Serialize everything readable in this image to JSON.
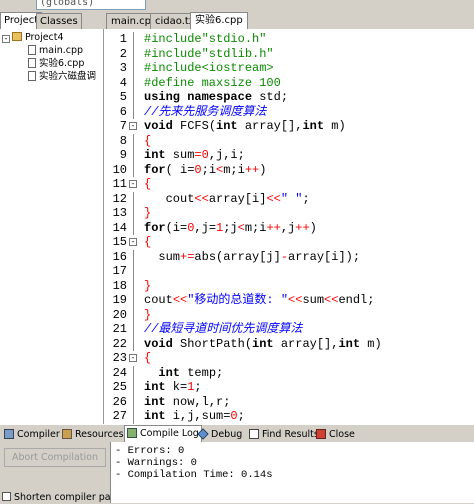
{
  "toolbar": {
    "scope_select": "(globals)"
  },
  "left_panel": {
    "tabs": [
      "Project",
      "Classes"
    ],
    "project_name": "Project4",
    "files": [
      "main.cpp",
      "实验6.cpp",
      "实验六磁盘调"
    ]
  },
  "file_tabs": [
    "main.cpp",
    "cidao.txt",
    "实验6.cpp"
  ],
  "editor": {
    "lines": [
      {
        "n": "1",
        "fold": "",
        "tokens": [
          {
            "t": "#include\"stdio.h\"",
            "c": "pp"
          }
        ]
      },
      {
        "n": "2",
        "fold": "",
        "tokens": [
          {
            "t": "#include\"stdlib.h\"",
            "c": "pp"
          }
        ]
      },
      {
        "n": "3",
        "fold": "",
        "tokens": [
          {
            "t": "#include<iostream>",
            "c": "pp"
          }
        ]
      },
      {
        "n": "4",
        "fold": "",
        "tokens": [
          {
            "t": "#define maxsize 100",
            "c": "pp"
          }
        ]
      },
      {
        "n": "5",
        "fold": "",
        "tokens": [
          {
            "t": "using namespace",
            "c": "kw"
          },
          {
            "t": " std;",
            "c": ""
          }
        ]
      },
      {
        "n": "6",
        "fold": "",
        "tokens": [
          {
            "t": "//先来先服务调度算法",
            "c": "cm"
          }
        ]
      },
      {
        "n": "7",
        "fold": "-",
        "tokens": [
          {
            "t": "void",
            "c": "kw"
          },
          {
            "t": " FCFS(",
            "c": ""
          },
          {
            "t": "int",
            "c": "kw"
          },
          {
            "t": " array[],",
            "c": ""
          },
          {
            "t": "int",
            "c": "kw"
          },
          {
            "t": " m)",
            "c": ""
          }
        ]
      },
      {
        "n": "8",
        "fold": "",
        "tokens": [
          {
            "t": "{",
            "c": "sym"
          }
        ]
      },
      {
        "n": "9",
        "fold": "",
        "tokens": [
          {
            "t": "int",
            "c": "kw"
          },
          {
            "t": " sum",
            "c": ""
          },
          {
            "t": "=",
            "c": "sym"
          },
          {
            "t": "0",
            "c": "num"
          },
          {
            "t": ",j,i;",
            "c": ""
          }
        ]
      },
      {
        "n": "10",
        "fold": "",
        "tokens": [
          {
            "t": "for",
            "c": "kw"
          },
          {
            "t": "( i=",
            "c": ""
          },
          {
            "t": "0",
            "c": "num"
          },
          {
            "t": ";i",
            "c": ""
          },
          {
            "t": "<",
            "c": "sym"
          },
          {
            "t": "m;i",
            "c": ""
          },
          {
            "t": "++",
            "c": "sym"
          },
          {
            "t": ")",
            "c": ""
          }
        ]
      },
      {
        "n": "11",
        "fold": "-",
        "tokens": [
          {
            "t": "{",
            "c": "sym"
          }
        ]
      },
      {
        "n": "12",
        "fold": "",
        "tokens": [
          {
            "t": "   cout",
            "c": ""
          },
          {
            "t": "<<",
            "c": "sym"
          },
          {
            "t": "array[i]",
            "c": ""
          },
          {
            "t": "<<",
            "c": "sym"
          },
          {
            "t": "\" \"",
            "c": "str"
          },
          {
            "t": ";",
            "c": ""
          }
        ]
      },
      {
        "n": "13",
        "fold": "",
        "tokens": [
          {
            "t": "}",
            "c": "sym"
          }
        ]
      },
      {
        "n": "14",
        "fold": "",
        "tokens": [
          {
            "t": "for",
            "c": "kw"
          },
          {
            "t": "(i=",
            "c": ""
          },
          {
            "t": "0",
            "c": "num"
          },
          {
            "t": ",j=",
            "c": ""
          },
          {
            "t": "1",
            "c": "num"
          },
          {
            "t": ";j",
            "c": ""
          },
          {
            "t": "<",
            "c": "sym"
          },
          {
            "t": "m;i",
            "c": ""
          },
          {
            "t": "++",
            "c": "sym"
          },
          {
            "t": ",j",
            "c": ""
          },
          {
            "t": "++",
            "c": "sym"
          },
          {
            "t": ")",
            "c": ""
          }
        ]
      },
      {
        "n": "15",
        "fold": "-",
        "tokens": [
          {
            "t": "{",
            "c": "sym"
          }
        ]
      },
      {
        "n": "16",
        "fold": "",
        "tokens": [
          {
            "t": "  sum",
            "c": ""
          },
          {
            "t": "+=",
            "c": "sym"
          },
          {
            "t": "abs(array[j]",
            "c": ""
          },
          {
            "t": "-",
            "c": "sym"
          },
          {
            "t": "array[i]);",
            "c": ""
          }
        ]
      },
      {
        "n": "17",
        "fold": "",
        "tokens": [
          {
            "t": "",
            "c": ""
          }
        ]
      },
      {
        "n": "18",
        "fold": "",
        "tokens": [
          {
            "t": "}",
            "c": "sym"
          }
        ]
      },
      {
        "n": "19",
        "fold": "",
        "tokens": [
          {
            "t": "cout",
            "c": ""
          },
          {
            "t": "<<",
            "c": "sym"
          },
          {
            "t": "\"移动的总道数: \"",
            "c": "str"
          },
          {
            "t": "<<",
            "c": "sym"
          },
          {
            "t": "sum",
            "c": ""
          },
          {
            "t": "<<",
            "c": "sym"
          },
          {
            "t": "endl;",
            "c": ""
          }
        ]
      },
      {
        "n": "20",
        "fold": "",
        "tokens": [
          {
            "t": "}",
            "c": "sym"
          }
        ]
      },
      {
        "n": "21",
        "fold": "",
        "tokens": [
          {
            "t": "//最短寻道时间优先调度算法",
            "c": "cm"
          }
        ]
      },
      {
        "n": "22",
        "fold": "",
        "tokens": [
          {
            "t": "void",
            "c": "kw"
          },
          {
            "t": " ShortPath(",
            "c": ""
          },
          {
            "t": "int",
            "c": "kw"
          },
          {
            "t": " array[],",
            "c": ""
          },
          {
            "t": "int",
            "c": "kw"
          },
          {
            "t": " m)",
            "c": ""
          }
        ]
      },
      {
        "n": "23",
        "fold": "-",
        "tokens": [
          {
            "t": "{",
            "c": "sym"
          }
        ]
      },
      {
        "n": "24",
        "fold": "",
        "tokens": [
          {
            "t": "  int",
            "c": "kw"
          },
          {
            "t": " temp;",
            "c": ""
          }
        ]
      },
      {
        "n": "25",
        "fold": "",
        "tokens": [
          {
            "t": "int",
            "c": "kw"
          },
          {
            "t": " k=",
            "c": ""
          },
          {
            "t": "1",
            "c": "num"
          },
          {
            "t": ";",
            "c": ""
          }
        ]
      },
      {
        "n": "26",
        "fold": "",
        "tokens": [
          {
            "t": "int",
            "c": "kw"
          },
          {
            "t": " now,l,r;",
            "c": ""
          }
        ]
      },
      {
        "n": "27",
        "fold": "",
        "tokens": [
          {
            "t": "int",
            "c": "kw"
          },
          {
            "t": " i,j,sum=",
            "c": ""
          },
          {
            "t": "0",
            "c": "num"
          },
          {
            "t": ";",
            "c": ""
          }
        ]
      }
    ]
  },
  "bottom_tabs": [
    "Compiler",
    "Resources",
    "Compile Log",
    "Debug",
    "Find Results",
    "Close"
  ],
  "bottom_panel": {
    "abort_button": "Abort Compilation",
    "shorten_checkbox": "Shorten compiler paths",
    "log_lines": [
      "- Errors: 0",
      "- Warnings: 0",
      "- Compilation Time: 0.14s"
    ]
  },
  "colors": {
    "preprocessor": "#0a8a00",
    "comment": "#0000ff",
    "symbol": "#ff0000",
    "background": "#d4d0c8"
  }
}
